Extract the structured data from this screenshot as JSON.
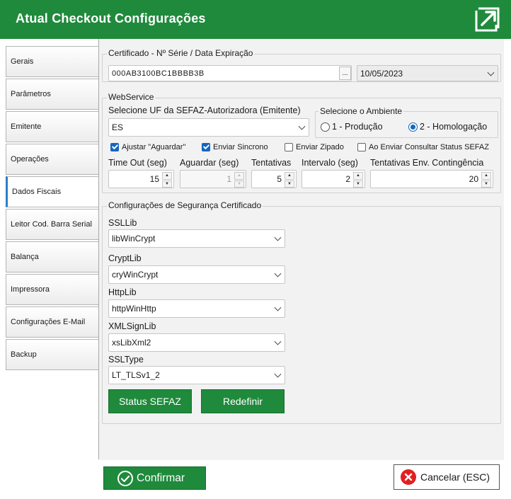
{
  "window": {
    "title": "Atual Checkout Configurações"
  },
  "sidebar": {
    "items": [
      {
        "label": "Gerais"
      },
      {
        "label": "Parâmetros"
      },
      {
        "label": "Emitente"
      },
      {
        "label": "Operações"
      },
      {
        "label": "Dados Fiscais",
        "active": true
      },
      {
        "label": "Leitor Cod. Barra Serial"
      },
      {
        "label": "Balança"
      },
      {
        "label": "Impressora"
      },
      {
        "label": "Configurações E-Mail"
      },
      {
        "label": "Backup"
      }
    ]
  },
  "certificado": {
    "legend": "Certificado - Nº Série / Data Expiração",
    "serie": "000AB3100BC1BBBB3B",
    "browse_label": "...",
    "data_expiracao": "10/05/2023"
  },
  "webservice": {
    "legend": "WebService",
    "uf_label": "Selecione UF da SEFAZ-Autorizadora (Emitente)",
    "uf_value": "ES",
    "ambiente_label": "Selecione o Ambiente",
    "ambiente_producao": "1 - Produção",
    "ambiente_homologacao": "2 - Homologação",
    "ambiente_selected": "homologacao",
    "checkboxes": {
      "ajustar": {
        "label": "Ajustar \"Aguardar\"",
        "checked": true
      },
      "sincrono": {
        "label": "Enviar Sincrono",
        "checked": true
      },
      "zipado": {
        "label": "Enviar Zipado",
        "checked": false
      },
      "consultar": {
        "label": "Ao Enviar Consultar Status SEFAZ",
        "checked": false
      }
    },
    "timeout_label": "Time Out (seg)",
    "timeout_value": "15",
    "aguardar_label": "Aguardar (seg)",
    "aguardar_value": "1",
    "tentativas_label": "Tentativas",
    "tentativas_value": "5",
    "intervalo_label": "Intervalo (seg)",
    "intervalo_value": "2",
    "contingencia_label": "Tentativas Env. Contingência",
    "contingencia_value": "20"
  },
  "seguranca": {
    "legend": "Configurações de Segurança Certificado",
    "ssllib_label": "SSLLib",
    "ssllib_value": "libWinCrypt",
    "cryptlib_label": "CryptLib",
    "cryptlib_value": "cryWinCrypt",
    "httplib_label": "HttpLib",
    "httplib_value": "httpWinHttp",
    "xmlsignlib_label": "XMLSignLib",
    "xmlsignlib_value": "xsLibXml2",
    "ssltype_label": "SSLType",
    "ssltype_value": "LT_TLSv1_2",
    "status_button": "Status SEFAZ",
    "redefinir_button": "Redefinir"
  },
  "footer": {
    "confirm_label": "Confirmar",
    "cancel_label": "Cancelar (ESC)"
  },
  "colors": {
    "brand_green": "#1f8a3c",
    "accent_blue": "#1565c0",
    "cancel_red": "#e02020"
  }
}
